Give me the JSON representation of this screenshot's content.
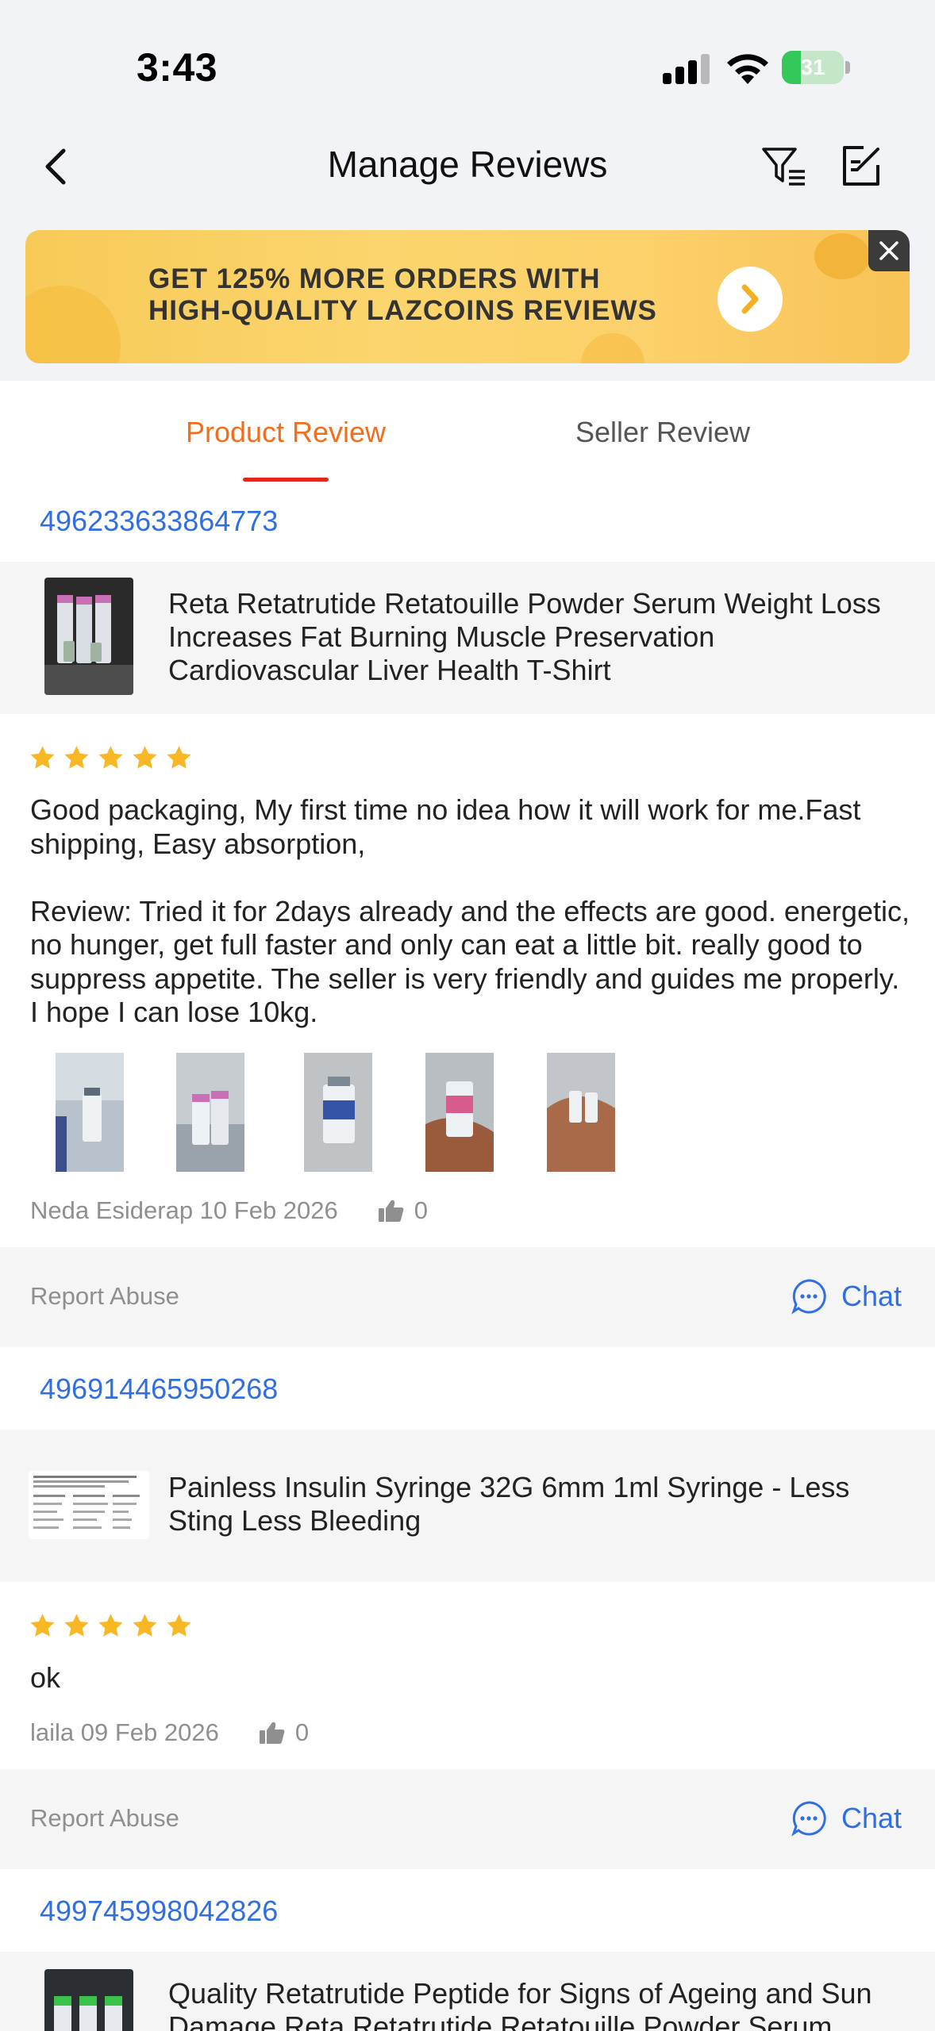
{
  "status": {
    "time": "3:43",
    "battery": "31",
    "battery_level": 0.31
  },
  "header": {
    "title": "Manage Reviews",
    "icons": [
      "back-icon",
      "filter-icon",
      "edit-icon"
    ]
  },
  "banner": {
    "line1": "GET 125% MORE ORDERS WITH",
    "line2": "HIGH-QUALITY LAZCOINS REVIEWS"
  },
  "tabs": {
    "product": "Product Review",
    "seller": "Seller Review",
    "active": "product"
  },
  "reviews": [
    {
      "order_id": "496233633864773",
      "product": "Reta Retatrutide Retatouille Powder Serum Weight Loss Increases Fat Burning Muscle Preservation Cardiovascular Liver Health T-Shirt",
      "rating": 5,
      "text": "Good packaging, My first time no idea how it will work for me.Fast shipping, Easy absorption,\n\nReview: Tried it for 2days already and the effects are good. energetic, no hunger, get full faster and only can eat a little bit. really good to suppress appetite. The seller is very friendly and guides me properly. I hope I can lose 10kg.",
      "photos": 5,
      "author_date": "Neda Esiderap 10 Feb 2026",
      "likes": "0",
      "report": "Report Abuse",
      "chat": "Chat"
    },
    {
      "order_id": "496914465950268",
      "product": "Painless Insulin Syringe 32G 6mm 1ml Syringe - Less Sting Less Bleeding",
      "rating": 5,
      "text": "ok",
      "author_date": "laila 09 Feb 2026",
      "likes": "0",
      "report": "Report Abuse",
      "chat": "Chat"
    },
    {
      "order_id": "499745998042826",
      "product": "Quality Retatrutide Peptide for Signs of Ageing and Sun Damage Reta Retatrutide Retatouille Powder Serum"
    }
  ],
  "colors": {
    "accent": "#f36e1c",
    "link": "#2f6ee3",
    "star": "#f8b826",
    "indicator": "#e3261c"
  }
}
